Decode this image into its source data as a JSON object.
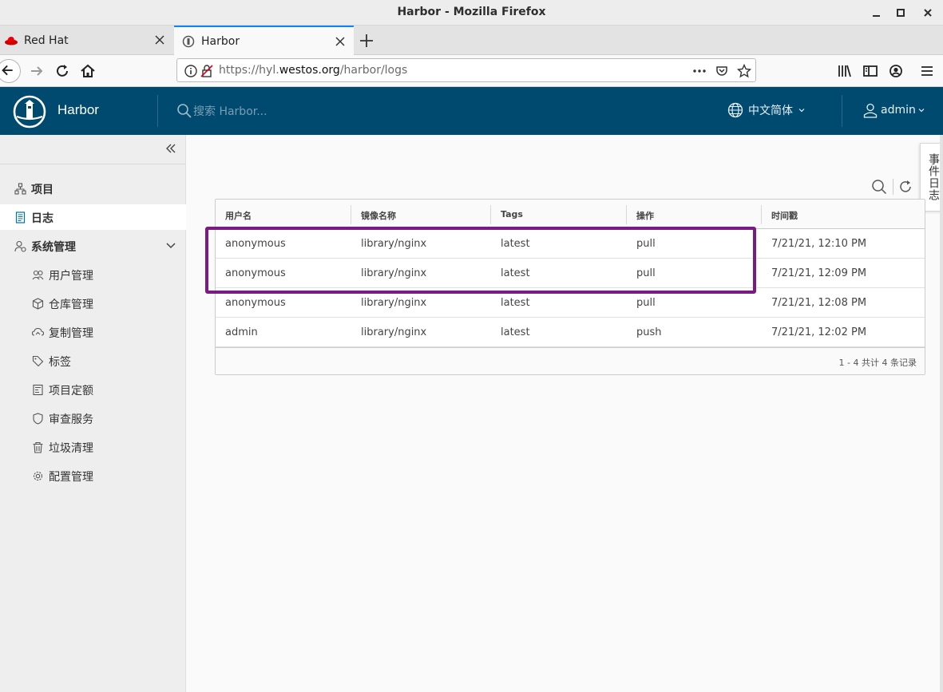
{
  "window": {
    "title": "Harbor - Mozilla Firefox"
  },
  "tabs": [
    {
      "label": "Red Hat",
      "icon": "redhat-icon"
    },
    {
      "label": "Harbor",
      "icon": "harbor-favicon-icon",
      "active": true
    }
  ],
  "navbar": {
    "url_prefix": "https://hyl.",
    "url_host": "westos.org",
    "url_path": "/harbor/logs"
  },
  "header": {
    "brand": "Harbor",
    "search_placeholder": "搜索 Harbor...",
    "language": "中文简体",
    "user": "admin",
    "bg_color": "#004a70"
  },
  "sidebar": {
    "items": [
      {
        "label": "项目",
        "icon": "projects-icon"
      },
      {
        "label": "日志",
        "icon": "logs-icon",
        "active": true
      },
      {
        "label": "系统管理",
        "icon": "admin-icon",
        "expanded": true
      }
    ],
    "sub_items": [
      {
        "label": "用户管理",
        "icon": "users-icon"
      },
      {
        "label": "仓库管理",
        "icon": "registry-icon"
      },
      {
        "label": "复制管理",
        "icon": "replication-icon"
      },
      {
        "label": "标签",
        "icon": "tag-icon"
      },
      {
        "label": "项目定额",
        "icon": "quota-icon"
      },
      {
        "label": "审查服务",
        "icon": "shield-icon"
      },
      {
        "label": "垃圾清理",
        "icon": "trash-icon"
      },
      {
        "label": "配置管理",
        "icon": "gear-icon"
      }
    ]
  },
  "event_tab": "事件日志",
  "table": {
    "columns": [
      "用户名",
      "镜像名称",
      "Tags",
      "操作",
      "时间戳"
    ],
    "rows": [
      [
        "anonymous",
        "library/nginx",
        "latest",
        "pull",
        "7/21/21, 12:10 PM"
      ],
      [
        "anonymous",
        "library/nginx",
        "latest",
        "pull",
        "7/21/21, 12:09 PM"
      ],
      [
        "anonymous",
        "library/nginx",
        "latest",
        "pull",
        "7/21/21, 12:08 PM"
      ],
      [
        "admin",
        "library/nginx",
        "latest",
        "push",
        "7/21/21, 12:02 PM"
      ]
    ],
    "footer": "1 - 4 共计 4 条记录"
  },
  "annotation": {
    "color": "#7a1a82"
  }
}
